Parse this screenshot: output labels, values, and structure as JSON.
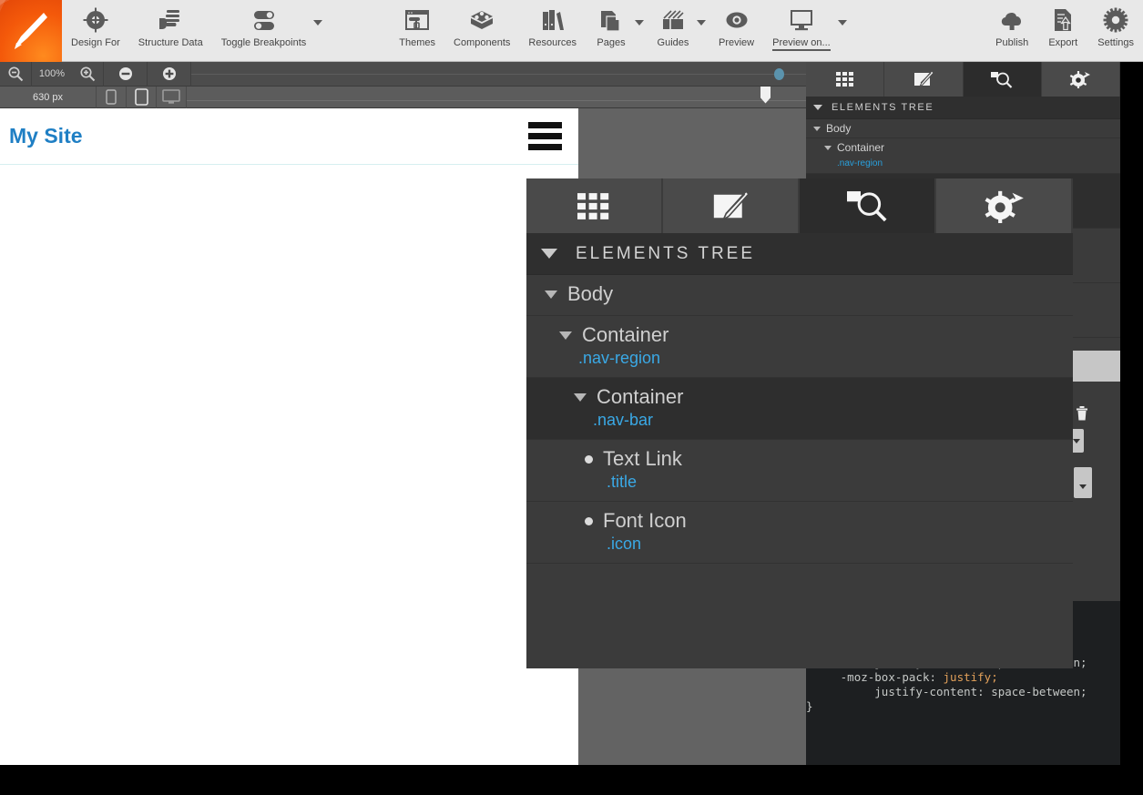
{
  "toolbar": {
    "logo": "paintbrush-logo",
    "items": [
      {
        "label": "Design For",
        "icon": "target-crosshair-icon",
        "caret": false,
        "active": false
      },
      {
        "label": "Structure Data",
        "icon": "hand-stack-icon",
        "caret": false,
        "active": false
      },
      {
        "label": "Toggle Breakpoints",
        "icon": "toggle-switches-icon",
        "caret": true,
        "active": false
      },
      {
        "label": "Themes",
        "icon": "paint-roller-window-icon",
        "caret": false,
        "active": false
      },
      {
        "label": "Components",
        "icon": "cube-nodes-icon",
        "caret": false,
        "active": false
      },
      {
        "label": "Resources",
        "icon": "books-icon",
        "caret": false,
        "active": false
      },
      {
        "label": "Pages",
        "icon": "pages-stack-icon",
        "caret": true,
        "active": false
      },
      {
        "label": "Guides",
        "icon": "guides-hatch-icon",
        "caret": true,
        "active": false
      },
      {
        "label": "Preview",
        "icon": "eye-icon",
        "caret": false,
        "active": false
      },
      {
        "label": "Preview on...",
        "icon": "monitor-icon",
        "caret": true,
        "active": true
      }
    ],
    "right_items": [
      {
        "label": "Publish",
        "icon": "cloud-upload-icon",
        "caret": false,
        "active": false
      },
      {
        "label": "Export",
        "icon": "document-upload-icon",
        "caret": false,
        "active": false
      },
      {
        "label": "Settings",
        "icon": "gear-icon",
        "caret": false,
        "active": false
      }
    ]
  },
  "zoombar": {
    "zoom_out_icon": "zoom-out-icon",
    "zoom_level": "100%",
    "zoom_in_icon": "zoom-in-icon",
    "minus_icon": "minus-circle-icon",
    "plus_icon": "plus-circle-icon",
    "breakpoint_dot_color": "#5b93ad"
  },
  "rulerbar": {
    "width_label": "630 px",
    "devices": [
      {
        "name": "device-phone-icon"
      },
      {
        "name": "device-tablet-icon"
      },
      {
        "name": "device-desktop-icon"
      }
    ]
  },
  "canvas": {
    "site": {
      "title": "My Site",
      "title_color": "#1f7fc4",
      "menu_icon": "hamburger-menu-icon"
    }
  },
  "inspector": {
    "tabs": [
      {
        "icon": "grid-icon",
        "selected": false
      },
      {
        "icon": "pencil-note-icon",
        "selected": false
      },
      {
        "icon": "magnifier-inspect-icon",
        "selected": true
      },
      {
        "icon": "gear-plus-icon",
        "selected": false
      }
    ],
    "section_title": "ELEMENTS TREE",
    "tree": [
      {
        "name": "Body",
        "class": "",
        "depth": 0,
        "kind": "caret",
        "selected": false
      },
      {
        "name": "Container",
        "class": ".nav-region",
        "depth": 1,
        "kind": "caret",
        "selected": false
      },
      {
        "name": "Container",
        "class": ".nav-bar",
        "depth": 2,
        "kind": "caret",
        "selected": true
      },
      {
        "name": "Text Link",
        "class": ".title",
        "depth": 3,
        "kind": "bullet",
        "selected": false
      },
      {
        "name": "Font Icon",
        "class": ".icon",
        "depth": 3,
        "kind": "bullet",
        "selected": false
      }
    ],
    "widgets": {
      "delete_icon": "trash-icon",
      "dropdown_1_icon": "chevron-down-icon",
      "dropdown_2_icon": "chevron-down-icon"
    }
  },
  "code_pane": {
    "lines": [
      {
        "indent": 2,
        "text": "-webkit-justify-content: space-between;",
        "kw": ""
      },
      {
        "indent": 5,
        "text": "-moz-box-pack: ",
        "kw": "justify;"
      },
      {
        "indent": 10,
        "text": "justify-content: space-between;",
        "kw": ""
      },
      {
        "indent": 0,
        "text": "}",
        "kw": ""
      }
    ]
  }
}
